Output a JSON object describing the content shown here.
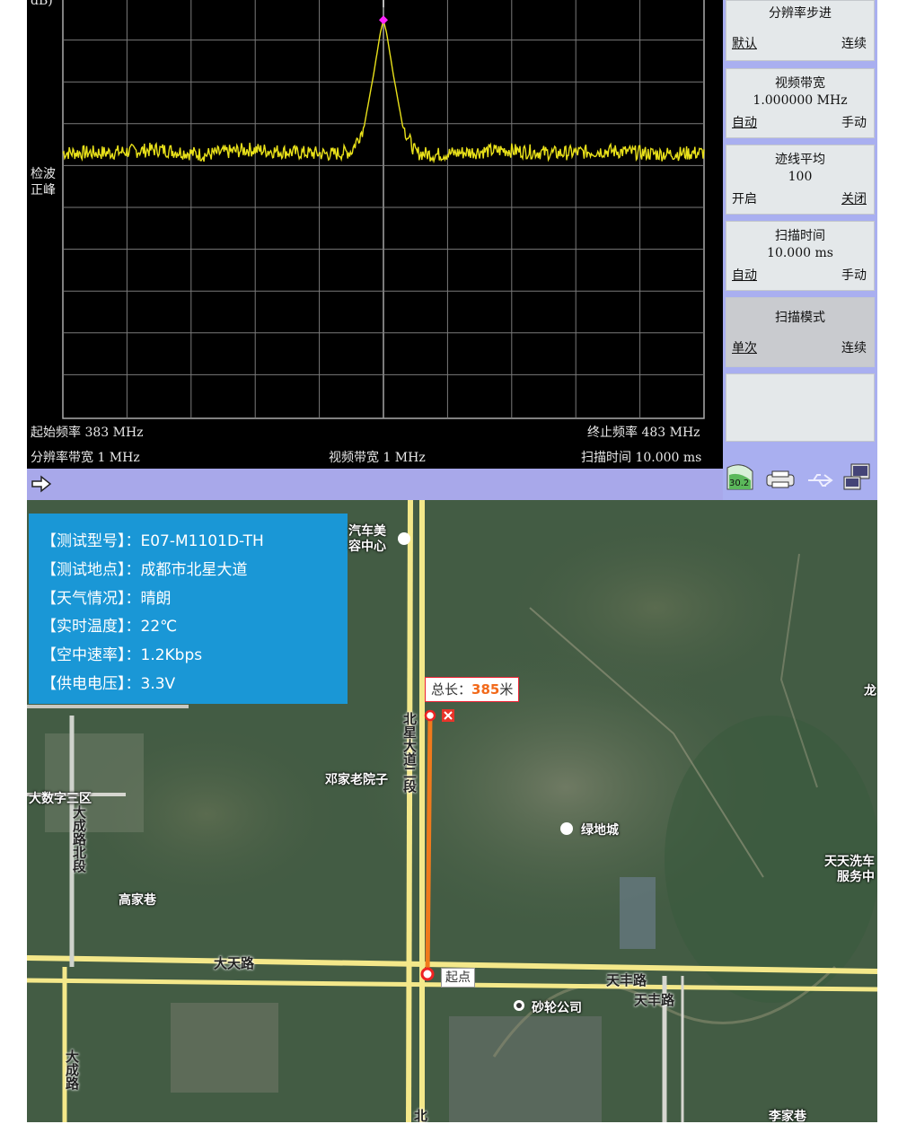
{
  "spectrum": {
    "y_unit": "dB)",
    "detector_label": [
      "检波",
      "正峰"
    ],
    "status": {
      "start_freq": "起始频率 383 MHz",
      "stop_freq": "终止频率 483 MHz",
      "rbw": "分辨率带宽 1 MHz",
      "vbw": "视频带宽 1 MHz",
      "sweep_time": "扫描时间 10.000 ms"
    },
    "colors": {
      "background": "#000000",
      "trace": "#e9e11a",
      "marker": "#ff22ff",
      "grid": "#7a7a7a"
    }
  },
  "chart_data": {
    "type": "line",
    "title": "",
    "xlabel": "",
    "ylabel": "",
    "xlim": [
      383,
      483
    ],
    "x_unit": "MHz",
    "grid": true,
    "series": [
      {
        "x": [
          383,
          390,
          398,
          405,
          412,
          420,
          425,
          428,
          430,
          431.5,
          432.5,
          433,
          433.5,
          434.5,
          436,
          438,
          441,
          445,
          452,
          460,
          468,
          476,
          483
        ],
        "y": [
          -20,
          -20,
          -19.5,
          -20.3,
          -19.5,
          -20,
          -20.2,
          -19.8,
          -16,
          -8,
          -2,
          0,
          -2,
          -8,
          -16,
          -20,
          -20.3,
          -20,
          -19.6,
          -20.1,
          -19.7,
          -20.2,
          -20
        ]
      }
    ],
    "ylim": [
      -60,
      3
    ],
    "marker": {
      "x": 433,
      "y": 0
    }
  },
  "softkeys": [
    {
      "title": "分辨率步进",
      "value": "",
      "left": "默认",
      "right": "连续",
      "selected": "left"
    },
    {
      "title": "视频带宽",
      "value": "1.000000 MHz",
      "left": "自动",
      "right": "手动",
      "selected": "left"
    },
    {
      "title": "迹线平均",
      "value": "100",
      "left": "开启",
      "right": "关闭",
      "selected": "right"
    },
    {
      "title": "扫描时间",
      "value": "10.000 ms",
      "left": "自动",
      "right": "手动",
      "selected": "left"
    },
    {
      "title": "扫描模式",
      "value": "",
      "left": "单次",
      "right": "连续",
      "selected": "left"
    }
  ],
  "status_icons": {
    "temperature": "30.2",
    "icons": [
      "thermometer-icon",
      "printer-icon",
      "usb-icon",
      "network-icon"
    ]
  },
  "info_panel": {
    "rows": [
      "【测试型号】：E07-M1101D-TH",
      "【测试地点】：成都市北星大道",
      "【天气情况】：晴朗",
      "【实时温度】：22℃",
      "【空中速率】：1.2Kbps",
      "【供电电压】：3.3V"
    ]
  },
  "map": {
    "distance_prefix": "总长：",
    "distance_value": "385",
    "distance_unit": "米",
    "start_label": "起点",
    "road_labels": {
      "beixing": "北星大道二段",
      "datian": "大天路",
      "tianfeng1": "天丰路",
      "tianfeng2": "天丰路",
      "dacheng": "大成路北段",
      "dacheng_south": "大成路",
      "bei": "北"
    },
    "place_labels": {
      "car": "汽车美",
      "car2": "容中心",
      "dengjia": "邓家老院子",
      "digital": "大数字三区",
      "gaojia": "高家巷",
      "lvdi": "绿地城",
      "tiantian": "天天洗车",
      "tiantian2": "服务中",
      "shalun": "砂轮公司",
      "lijia": "李家巷",
      "long": "龙"
    },
    "colors": {
      "route": "#f07a1c",
      "info_bg": "#1a97d6",
      "road": "#f4e88a"
    }
  }
}
